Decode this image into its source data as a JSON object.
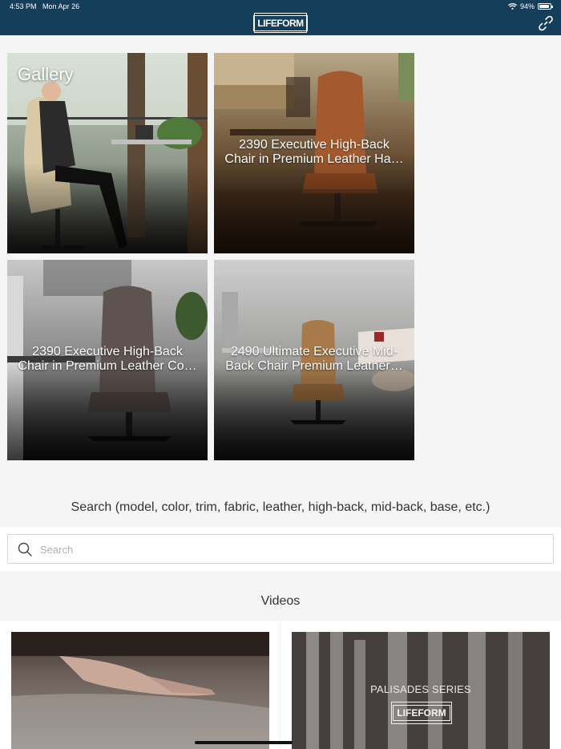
{
  "status_bar": {
    "time": "4:53 PM",
    "date": "Mon Apr 26",
    "battery": "94%",
    "battery_level": 0.94
  },
  "header": {
    "logo_text": "LIFEFORM",
    "link_icon": "link-icon"
  },
  "gallery": {
    "label": "Gallery",
    "tiles": [
      {
        "caption": ""
      },
      {
        "caption": "2390 Executive High-Back Chair in Premium Leather Ha…"
      },
      {
        "caption": "2390 Executive High-Back Chair in Premium Leather Co…"
      },
      {
        "caption": "2490 Ultimate Executive Mid-Back Chair Premium Leather…"
      }
    ]
  },
  "search": {
    "title": "Search (model, color, trim, fabric, leather, high-back, mid-back, base, etc.)",
    "placeholder": "Search",
    "value": ""
  },
  "videos": {
    "title": "Videos",
    "items": [
      {
        "overlay_series": "",
        "overlay_logo": ""
      },
      {
        "overlay_series": "PALISADES SERIES",
        "overlay_logo": "LIFEFORM"
      }
    ]
  }
}
